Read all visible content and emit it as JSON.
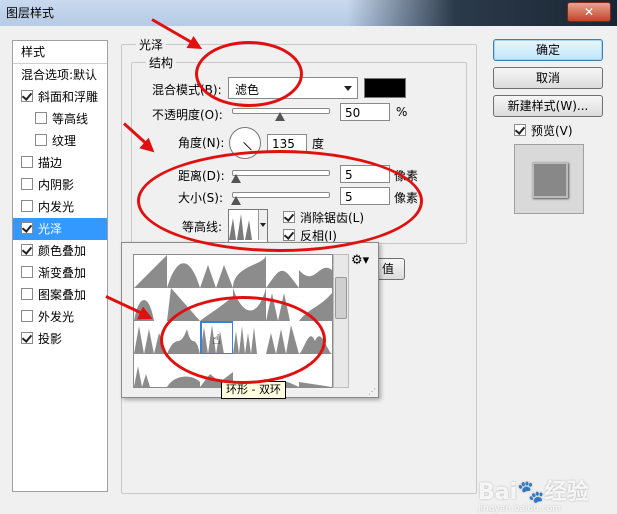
{
  "window": {
    "title": "图层样式",
    "close_label": "✕"
  },
  "styles_list": {
    "header": "样式",
    "items": [
      {
        "label": "混合选项:默认",
        "checkbox": false,
        "checked": false,
        "sub": false,
        "selected": false
      },
      {
        "label": "斜面和浮雕",
        "checkbox": true,
        "checked": true,
        "sub": false,
        "selected": false
      },
      {
        "label": "等高线",
        "checkbox": true,
        "checked": false,
        "sub": true,
        "selected": false
      },
      {
        "label": "纹理",
        "checkbox": true,
        "checked": false,
        "sub": true,
        "selected": false
      },
      {
        "label": "描边",
        "checkbox": true,
        "checked": false,
        "sub": false,
        "selected": false
      },
      {
        "label": "内阴影",
        "checkbox": true,
        "checked": false,
        "sub": false,
        "selected": false
      },
      {
        "label": "内发光",
        "checkbox": true,
        "checked": false,
        "sub": false,
        "selected": false
      },
      {
        "label": "光泽",
        "checkbox": true,
        "checked": true,
        "sub": false,
        "selected": true
      },
      {
        "label": "颜色叠加",
        "checkbox": true,
        "checked": true,
        "sub": false,
        "selected": false
      },
      {
        "label": "渐变叠加",
        "checkbox": true,
        "checked": false,
        "sub": false,
        "selected": false
      },
      {
        "label": "图案叠加",
        "checkbox": true,
        "checked": false,
        "sub": false,
        "selected": false
      },
      {
        "label": "外发光",
        "checkbox": true,
        "checked": false,
        "sub": false,
        "selected": false
      },
      {
        "label": "投影",
        "checkbox": true,
        "checked": true,
        "sub": false,
        "selected": false
      }
    ]
  },
  "satin": {
    "group_title": "光泽",
    "structure_title": "结构",
    "blend_mode_label": "混合模式(B):",
    "blend_mode_value": "滤色",
    "color": "#000000",
    "opacity_label": "不透明度(O):",
    "opacity_value": "50",
    "opacity_unit": "%",
    "opacity_fraction": 0.5,
    "angle_label": "角度(N):",
    "angle_value": "135",
    "angle_unit": "度",
    "distance_label": "距离(D):",
    "distance_value": "5",
    "distance_unit": "像素",
    "size_label": "大小(S):",
    "size_value": "5",
    "size_unit": "像素",
    "contour_label": "等高线:",
    "antialias_label": "消除锯齿(L)",
    "antialias_checked": true,
    "invert_label": "反相(I)",
    "invert_checked": true,
    "default_button_partial": "值"
  },
  "contour_picker": {
    "tooltip": "环形 - 双环",
    "gear_icon": "gear-icon"
  },
  "buttons": {
    "ok": "确定",
    "cancel": "取消",
    "new_style": "新建样式(W)...",
    "preview_label": "预览(V)",
    "preview_checked": true
  },
  "watermark": {
    "brand": "Bai",
    "suffix": "经验",
    "url": "jingyan.baidu.com"
  },
  "annotation_color": "#e01010"
}
